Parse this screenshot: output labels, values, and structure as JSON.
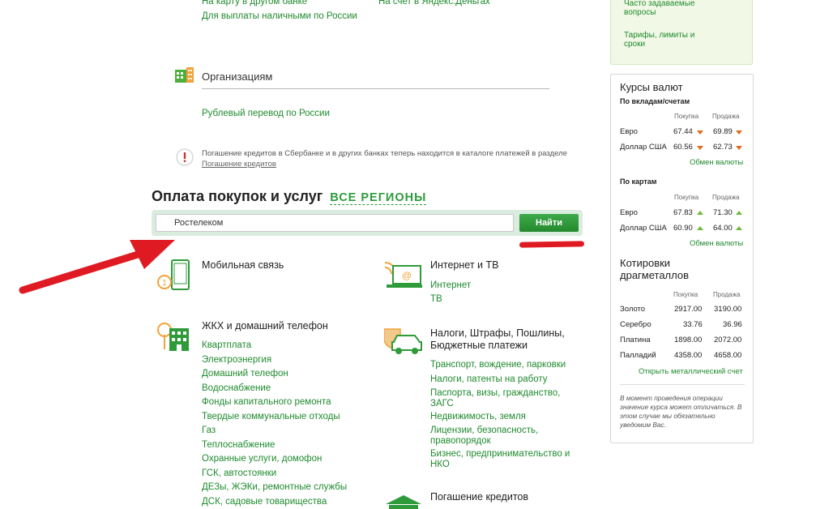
{
  "top_links": {
    "card_other_bank": "На карту в другом банке",
    "cash_russia": "Для выплаты наличными по России",
    "yandex": "На счет в Яндекс.Деньгах"
  },
  "organizations": {
    "title": "Организациям",
    "ruble_transfer": "Рублевый перевод по России"
  },
  "notice": {
    "text": "Погашение кредитов в Сбербанке и в других банках теперь находится в каталоге платежей в разделе",
    "link": "Погашение кредитов"
  },
  "payments": {
    "heading": "Оплата покупок и услуг",
    "regions": "ВСЕ РЕГИОНЫ",
    "search_value": "Ростелеком",
    "search_button": "Найти"
  },
  "categories": {
    "mobile": {
      "title": "Мобильная связь"
    },
    "internet": {
      "title": "Интернет и ТВ",
      "links": [
        "Интернет",
        "ТВ"
      ]
    },
    "housing": {
      "title": "ЖКХ и домашний телефон",
      "links": [
        "Квартплата",
        "Электроэнергия",
        "Домашний телефон",
        "Водоснабжение",
        "Фонды капитального ремонта",
        "Твердые коммунальные отходы",
        "Газ",
        "Теплоснабжение",
        "Охранные услуги, домофон",
        "ГСК, автостоянки",
        "ДЕЗы, ЖЭКи, ремонтные службы",
        "ДСК, садовые товарищества"
      ]
    },
    "taxes": {
      "title_line1": "Налоги, Штрафы, Пошлины,",
      "title_line2": "Бюджетные платежи",
      "links": [
        {
          "l1": "Транспорт, вождение, парковки",
          "l2": ""
        },
        {
          "l1": "Налоги, патенты на работу",
          "l2": ""
        },
        {
          "l1": "Паспорта, визы, гражданство,",
          "l2": "ЗАГС"
        },
        {
          "l1": "Недвижимость, земля",
          "l2": ""
        },
        {
          "l1": "Лицензии, безопасность,",
          "l2": "правопорядок"
        },
        {
          "l1": "Бизнес, предпринимательство и",
          "l2": "НКО"
        }
      ]
    },
    "loans": {
      "title": "Погашение кредитов"
    }
  },
  "sidebar_top": {
    "faq_l1": "Часто задаваемые",
    "faq_l2": "вопросы",
    "tariffs_l1": "Тарифы, лимиты и",
    "tariffs_l2": "сроки"
  },
  "rates": {
    "title": "Курсы валют",
    "deposits_title": "По вкладам/счетам",
    "cards_title": "По картам",
    "col_buy": "Покупка",
    "col_sell": "Продажа",
    "deposits": [
      {
        "name": "Евро",
        "buy": "67.44",
        "sell": "69.89"
      },
      {
        "name": "Доллар США",
        "buy": "60.56",
        "sell": "62.73"
      }
    ],
    "cards": [
      {
        "name": "Евро",
        "buy": "67.83",
        "sell": "71.30"
      },
      {
        "name": "Доллар США",
        "buy": "60.90",
        "sell": "64.00"
      }
    ],
    "exchange_link": "Обмен валюты"
  },
  "metals": {
    "title_l1": "Котировки",
    "title_l2": "драгметаллов",
    "col_buy": "Покупка",
    "col_sell": "Продажа",
    "rows": [
      {
        "name": "Золото",
        "buy": "2917.00",
        "sell": "3190.00"
      },
      {
        "name": "Серебро",
        "buy": "33.76",
        "sell": "36.96"
      },
      {
        "name": "Платина",
        "buy": "1898.00",
        "sell": "2072.00"
      },
      {
        "name": "Палладий",
        "buy": "4358.00",
        "sell": "4658.00"
      }
    ],
    "open_account": "Открыть металлический счет",
    "note": "В момент проведения операции значение курса может отличаться. В этом случае мы обязательно уведомим Вас."
  },
  "colors": {
    "brand_green": "#1f8a2e",
    "button_green": "#2e9a3a",
    "arrow_red": "#e01a22",
    "rate_down": "#e06a1e",
    "rate_up": "#6fba3a"
  }
}
